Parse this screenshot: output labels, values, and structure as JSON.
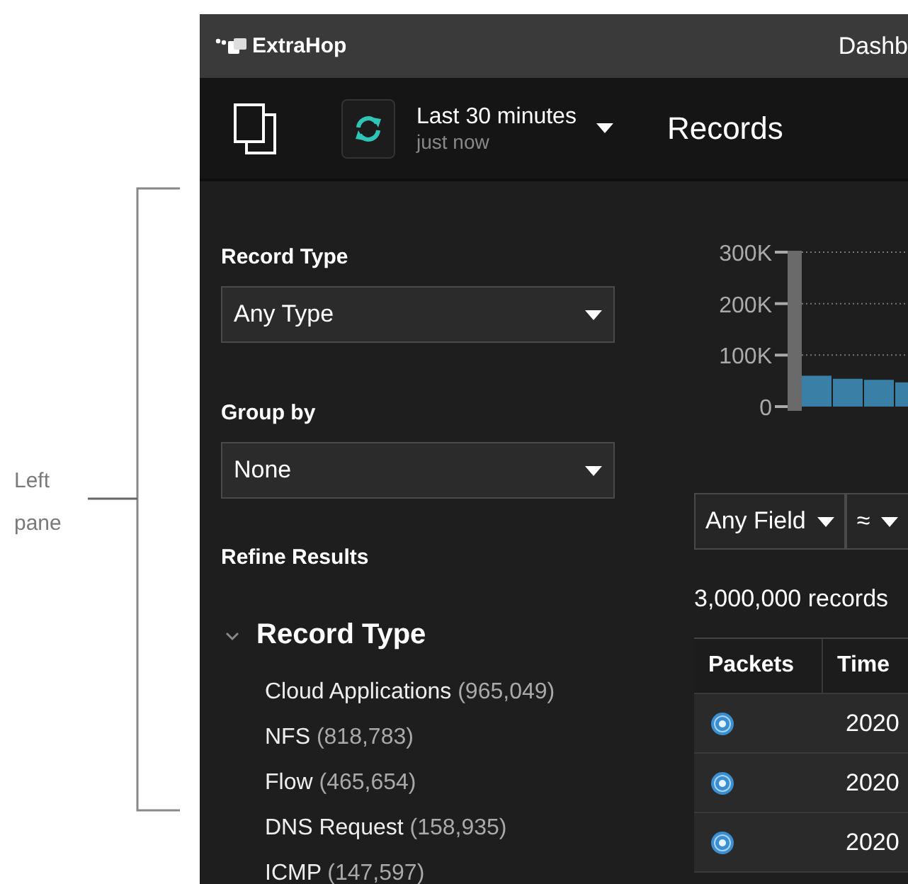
{
  "annotation": {
    "label": "Left pane"
  },
  "header": {
    "logo": "ExtraHop",
    "nav": [
      "Dashb"
    ]
  },
  "toolbar": {
    "time_range": "Last 30 minutes",
    "updated": "just now",
    "page_title": "Records"
  },
  "left_pane": {
    "record_type": {
      "label": "Record Type",
      "value": "Any Type"
    },
    "group_by": {
      "label": "Group by",
      "value": "None"
    },
    "refine_title": "Refine Results",
    "facets": [
      {
        "title": "Record Type",
        "expanded": true,
        "items": [
          {
            "name": "Cloud Applications",
            "count": "(965,049)"
          },
          {
            "name": "NFS",
            "count": "(818,783)"
          },
          {
            "name": "Flow",
            "count": "(465,654)"
          },
          {
            "name": "DNS Request",
            "count": "(158,935)"
          },
          {
            "name": "ICMP",
            "count": "(147,597)"
          }
        ]
      }
    ]
  },
  "chart_data": {
    "type": "bar",
    "ylim": [
      0,
      300000
    ],
    "categories": [
      null,
      null,
      null,
      null
    ],
    "yticks": [
      {
        "value": 0,
        "label": "0"
      },
      {
        "value": 100000,
        "label": "100K"
      },
      {
        "value": 200000,
        "label": "200K"
      },
      {
        "value": 300000,
        "label": "300K"
      }
    ],
    "series": [
      {
        "color": "#3a7fa6",
        "values": [
          60000,
          54000,
          52000,
          47000
        ]
      }
    ]
  },
  "filter": {
    "field": "Any Field",
    "operator": "≈"
  },
  "record_count": "3,000,000 records",
  "table": {
    "columns": [
      "Packets",
      "Time"
    ],
    "rows": [
      {
        "time": "2020"
      },
      {
        "time": "2020"
      },
      {
        "time": "2020"
      }
    ]
  }
}
